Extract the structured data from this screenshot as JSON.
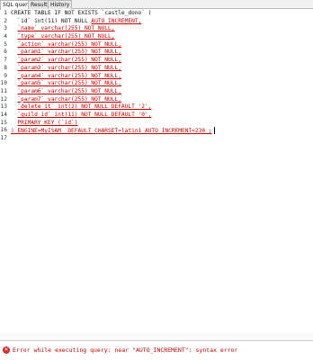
{
  "tabs": [
    {
      "label": "SQL query"
    },
    {
      "label": "Results"
    },
    {
      "label": "History"
    }
  ],
  "line_numbers": [
    "1",
    "2",
    "3",
    "4",
    "5",
    "6",
    "7",
    "8",
    "9",
    "10",
    "11",
    "12",
    "13",
    "14",
    "15",
    "16",
    "17"
  ],
  "code_lines": [
    {
      "plain": "CREATE TABLE IF NOT EXISTS `castle_dono` (",
      "err": ""
    },
    {
      "plain": "  `id` int(11) NOT NULL ",
      "err": "AUTO_INCREMENT,"
    },
    {
      "plain": "  ",
      "err": "`name` varchar(255) NOT NULL,"
    },
    {
      "plain": "  ",
      "err": "`type` varchar(255) NOT NULL,"
    },
    {
      "plain": "  ",
      "err": "`action` varchar(255) NOT NULL,"
    },
    {
      "plain": "  ",
      "err": "`param1` varchar(255) NOT NULL,"
    },
    {
      "plain": "  ",
      "err": "`param2` varchar(255) NOT NULL,"
    },
    {
      "plain": "  ",
      "err": "`param3` varchar(255) NOT NULL,"
    },
    {
      "plain": "  ",
      "err": "`param4` varchar(255) NOT NULL,"
    },
    {
      "plain": "  ",
      "err": "`param5` varchar(255) NOT NULL,"
    },
    {
      "plain": "  ",
      "err": "`param6` varchar(255) NOT NULL,"
    },
    {
      "plain": "  ",
      "err": "`param7` varchar(255) NOT NULL,"
    },
    {
      "plain": "  ",
      "err": "`delete_it` int(2) NOT NULL DEFAULT '2',"
    },
    {
      "plain": "  ",
      "err": "`guild_id` int(11) NOT NULL DEFAULT '0',"
    },
    {
      "plain": "  ",
      "err": "PRIMARY KEY (`id`)"
    },
    {
      "plain": "",
      "err": ") ENGINE=MyISAM  DEFAULT CHARSET=latin1 AUTO_INCREMENT=230 ;"
    },
    {
      "plain": "",
      "err": ""
    }
  ],
  "status": {
    "message": "Error while executing query: near \"AUTO_INCREMENT\": syntax error",
    "icon": "error-icon",
    "color": "#c00000"
  }
}
